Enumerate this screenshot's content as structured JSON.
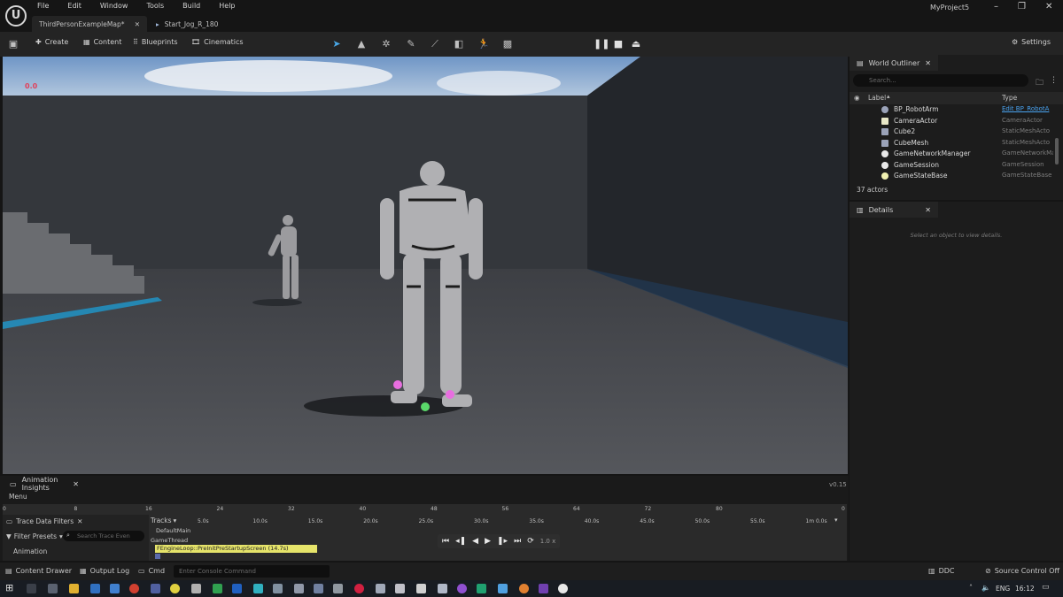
{
  "menubar": [
    "File",
    "Edit",
    "Window",
    "Tools",
    "Build",
    "Help"
  ],
  "tabs": {
    "map": "ThirdPersonExampleMap*",
    "anim": "Start_Jog_R_180"
  },
  "project_name": "MyProject5",
  "toolbar": {
    "create": "Create",
    "content": "Content",
    "blueprints": "Blueprints",
    "cinematics": "Cinematics",
    "settings": "Settings"
  },
  "viewport": {
    "fps": "0.0"
  },
  "outliner": {
    "title": "World Outliner",
    "search_placeholder": "Search...",
    "col_label": "Label",
    "col_type": "Type",
    "rows": [
      {
        "name": "BP_RobotArm",
        "type": "Edit BP_RobotA",
        "color": "#9aa2b8"
      },
      {
        "name": "CameraActor",
        "type": "CameraActor",
        "color": "#e8e8c8"
      },
      {
        "name": "Cube2",
        "type": "StaticMeshActo",
        "color": "#9aa2b8"
      },
      {
        "name": "CubeMesh",
        "type": "StaticMeshActo",
        "color": "#9aa2b8"
      },
      {
        "name": "GameNetworkManager",
        "type": "GameNetworkMa",
        "color": "#e8e8e8"
      },
      {
        "name": "GameSession",
        "type": "GameSession",
        "color": "#e8e8e8"
      },
      {
        "name": "GameStateBase",
        "type": "GameStateBase",
        "color": "#f0f0b0"
      }
    ],
    "actor_count": "37 actors"
  },
  "details": {
    "title": "Details",
    "empty_text": "Select an object to view details."
  },
  "insights": {
    "title": "Animation Insights",
    "version": "v0.15",
    "menu": "Menu",
    "frame_ticks": [
      "0",
      "8",
      "16",
      "24",
      "32",
      "40",
      "48",
      "56",
      "64",
      "72",
      "80",
      "0"
    ],
    "time_ticks": [
      "5.0s",
      "10.0s",
      "15.0s",
      "20.0s",
      "25.0s",
      "30.0s",
      "35.0s",
      "40.0s",
      "45.0s",
      "50.0s",
      "55.0s",
      "1m 0.0s"
    ],
    "trace_filters": "Trace Data Filters",
    "filter_presets": "Filter Presets",
    "search_placeholder": "Search Trace Even",
    "animation_item": "Animation",
    "tracks": "Tracks",
    "default_main": "DefaultMain",
    "game_thread": "GameThread",
    "event_bar": "FEngineLoop::PreInitPreStartupScreen (14.7s)",
    "speed": "1.0 x"
  },
  "statusbar": {
    "content_drawer": "Content Drawer",
    "output_log": "Output Log",
    "cmd": "Cmd",
    "console_placeholder": "Enter Console Command",
    "ddc": "DDC",
    "source_control": "Source Control Off"
  },
  "taskbar": {
    "lang": "ENG",
    "time": "16:12"
  }
}
